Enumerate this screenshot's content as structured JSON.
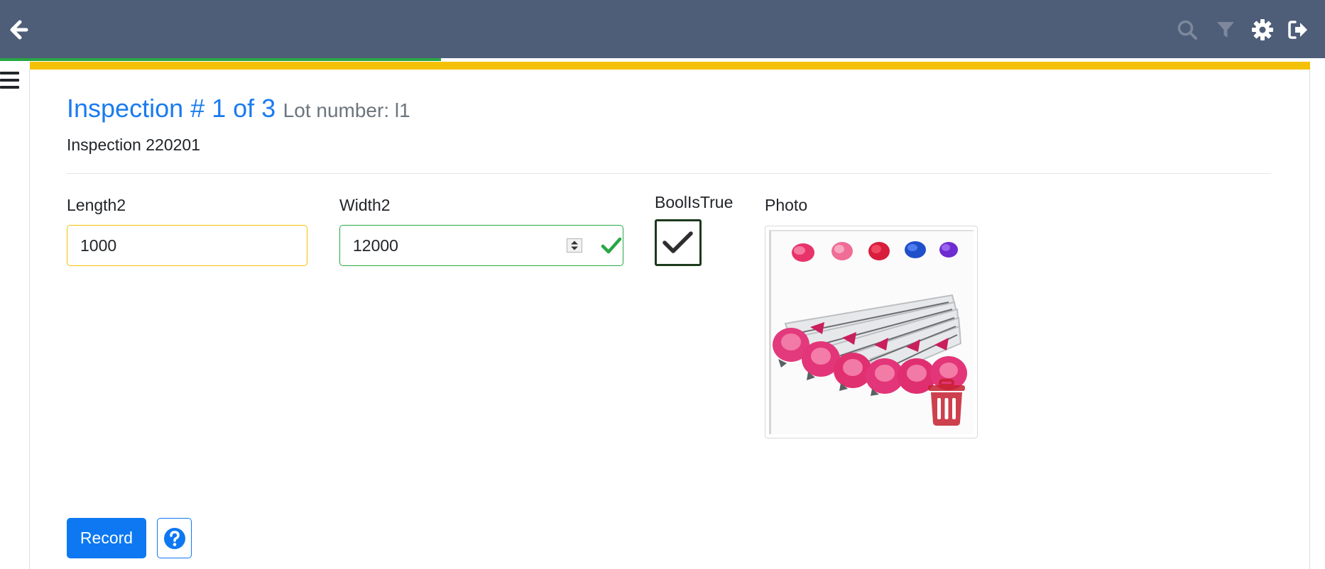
{
  "colors": {
    "navbar": "#4e5d78",
    "primary": "#1a7bf0",
    "success": "#28a745",
    "warning": "#f5c108",
    "muted": "#6c757d"
  },
  "navbar": {
    "icons": [
      "arrow-left-icon",
      "search-icon",
      "filter-icon",
      "gear-icon",
      "sign-out-icon"
    ]
  },
  "progress": {
    "fraction": 0.333
  },
  "header": {
    "title": "Inspection # 1 of 3",
    "lot_label": "Lot number: l1",
    "subtitle": "Inspection 220201"
  },
  "form": {
    "length": {
      "label": "Length2",
      "value": "1000"
    },
    "width": {
      "label": "Width2",
      "value": "12000"
    },
    "bool": {
      "label": "BoolIsTrue",
      "checked": true
    },
    "photo": {
      "label": "Photo"
    }
  },
  "actions": {
    "record_label": "Record",
    "help_icon": "question-circle-icon"
  }
}
